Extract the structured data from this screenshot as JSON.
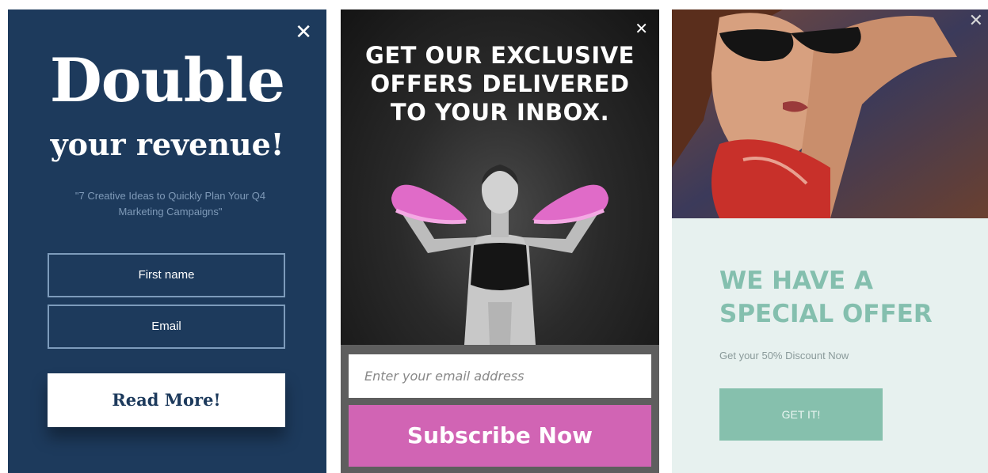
{
  "popup_revenue": {
    "close_glyph": "✕",
    "title_line1": "Double",
    "title_line2": "your revenue!",
    "subtitle": "\"7 Creative Ideas to Quickly Plan Your Q4 Marketing Campaigns\"",
    "first_name_placeholder": "First name",
    "email_placeholder": "Email",
    "button_label": "Read More!",
    "bg_color": "#1d3a5c"
  },
  "popup_subscribe": {
    "close_glyph": "✕",
    "headline_line1": "GET OUR EXCLUSIVE",
    "headline_line2": "OFFERS DELIVERED",
    "headline_line3": "TO YOUR INBOX.",
    "email_placeholder": "Enter your email address",
    "button_label": "Subscribe Now",
    "button_color": "#d164b4"
  },
  "popup_offer": {
    "close_glyph": "✕",
    "headline_line1": "WE HAVE A",
    "headline_line2": "SPECIAL OFFER",
    "subtitle": "Get your 50% Discount Now",
    "button_label": "GET IT!",
    "accent_color": "#86c0ad"
  }
}
